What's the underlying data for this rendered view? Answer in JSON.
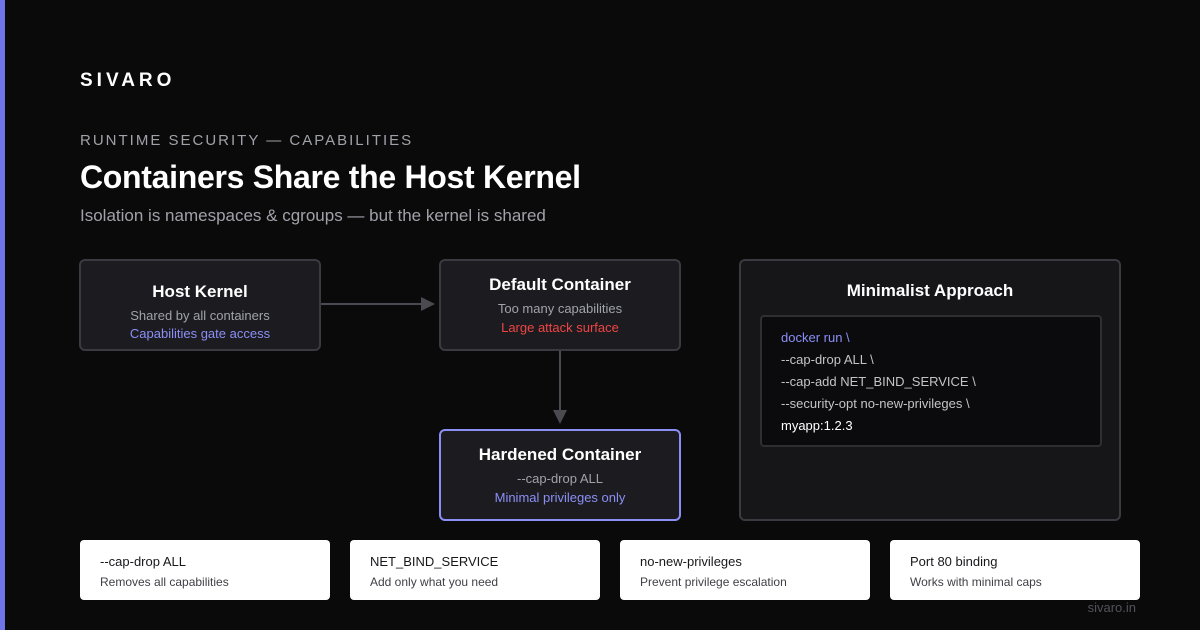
{
  "brand": "SIVARO",
  "eyebrow": "RUNTIME SECURITY — CAPABILITIES",
  "title": "Containers Share the Host Kernel",
  "subtitle": "Isolation is namespaces & cgroups — but the kernel is shared",
  "nodes": {
    "host": {
      "title": "Host Kernel",
      "line1": "Shared by all containers",
      "line2": "Capabilities gate access"
    },
    "default": {
      "title": "Default Container",
      "line1": "Too many capabilities",
      "line2": "Large attack surface"
    },
    "hardened": {
      "title": "Hardened Container",
      "line1": "--cap-drop ALL",
      "line2": "Minimal privileges only"
    }
  },
  "minimalist": {
    "title": "Minimalist Approach",
    "code": [
      "docker run \\",
      "--cap-drop ALL \\",
      "--cap-add NET_BIND_SERVICE \\",
      "--security-opt no-new-privileges \\",
      "myapp:1.2.3"
    ]
  },
  "cards": [
    {
      "title": "--cap-drop ALL",
      "desc": "Removes all capabilities"
    },
    {
      "title": "NET_BIND_SERVICE",
      "desc": "Add only what you need"
    },
    {
      "title": "no-new-privileges",
      "desc": "Prevent privilege escalation"
    },
    {
      "title": "Port 80 binding",
      "desc": "Works with minimal caps"
    }
  ],
  "footer": "sivaro.in",
  "colors": {
    "accent": "#8b8ff5",
    "danger": "#ef4444",
    "background": "#0a0a0b",
    "accent_bar": "#6f74e8"
  }
}
